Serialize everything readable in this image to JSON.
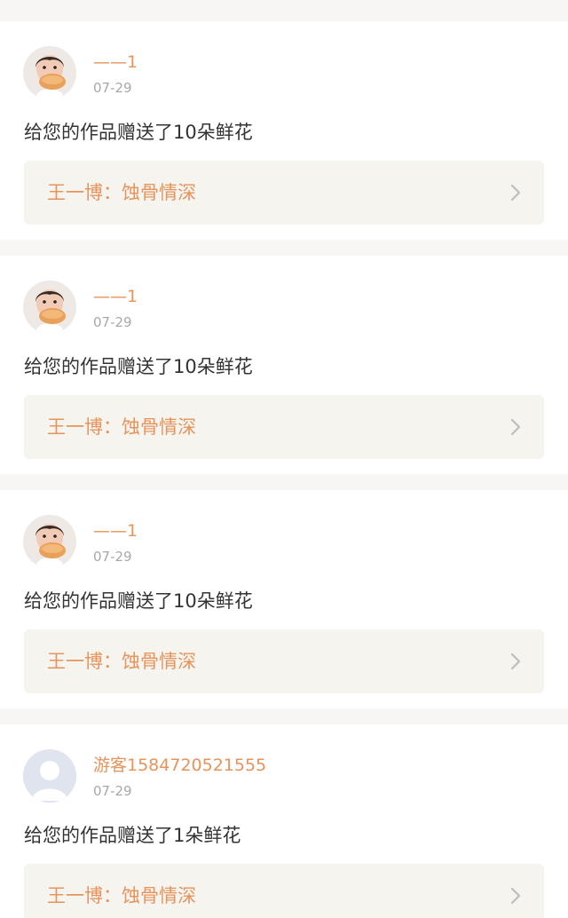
{
  "notifications": [
    {
      "avatar": "baby-photo-avatar",
      "user_name": "——1",
      "date": "07-29",
      "message": "给您的作品赠送了10朵鲜花",
      "work_title": "王一博：蚀骨情深"
    },
    {
      "avatar": "baby-photo-avatar",
      "user_name": "——1",
      "date": "07-29",
      "message": "给您的作品赠送了10朵鲜花",
      "work_title": "王一博：蚀骨情深"
    },
    {
      "avatar": "baby-photo-avatar",
      "user_name": "——1",
      "date": "07-29",
      "message": "给您的作品赠送了10朵鲜花",
      "work_title": "王一博：蚀骨情深"
    },
    {
      "avatar": "default-guest-avatar",
      "user_name": "游客1584720521555",
      "date": "07-29",
      "message": "给您的作品赠送了1朵鲜花",
      "work_title": "王一博：蚀骨情深"
    }
  ],
  "colors": {
    "accent": "#e6935c",
    "page_background": "#f8f5f5",
    "card_background": "#ffffff",
    "link_box_background": "#f6f4ef",
    "date_gray": "#a8a8a8",
    "body_text": "#333333"
  }
}
